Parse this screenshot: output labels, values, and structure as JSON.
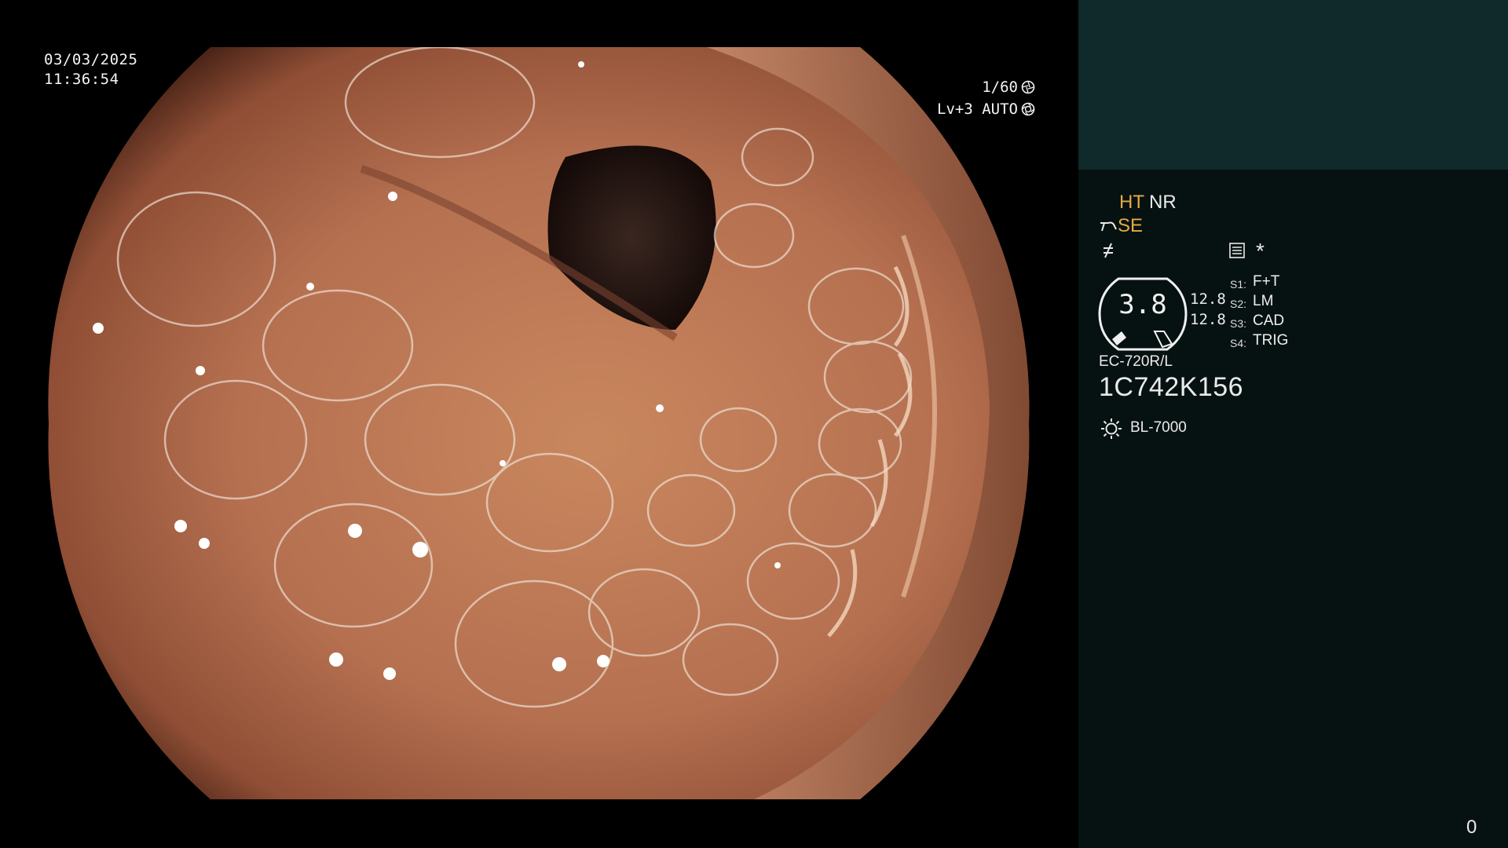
{
  "overlay": {
    "date": "03/03/2025",
    "time": "11:36:54",
    "shutter": "1/60",
    "shutter_icon": "shutter-icon",
    "exposure": "Lv+3 AUTO",
    "exposure_icon": "iris-icon"
  },
  "panel": {
    "ht_label": "HT",
    "nr_label": "NR",
    "se_label": "SE",
    "gauge_value": "3.8",
    "value_a": "12.8",
    "value_b": "12.8",
    "switches": [
      {
        "key": "S1:",
        "value": "F+T"
      },
      {
        "key": "S2:",
        "value": "LM"
      },
      {
        "key": "S3:",
        "value": "CAD"
      },
      {
        "key": "S4:",
        "value": "TRIG"
      }
    ],
    "asterisk": "*",
    "scope_model": "EC-720R/L",
    "serial": "1C742K156",
    "light_source": "BL-7000",
    "frame_counter": "0",
    "colors": {
      "accent": "#e8a944",
      "panel_bg": "#061211",
      "panel_top_bg": "#10292a"
    },
    "icons": [
      "structure-enhance-icon",
      "freeze-icon",
      "menu-icon",
      "light-source-icon"
    ]
  }
}
